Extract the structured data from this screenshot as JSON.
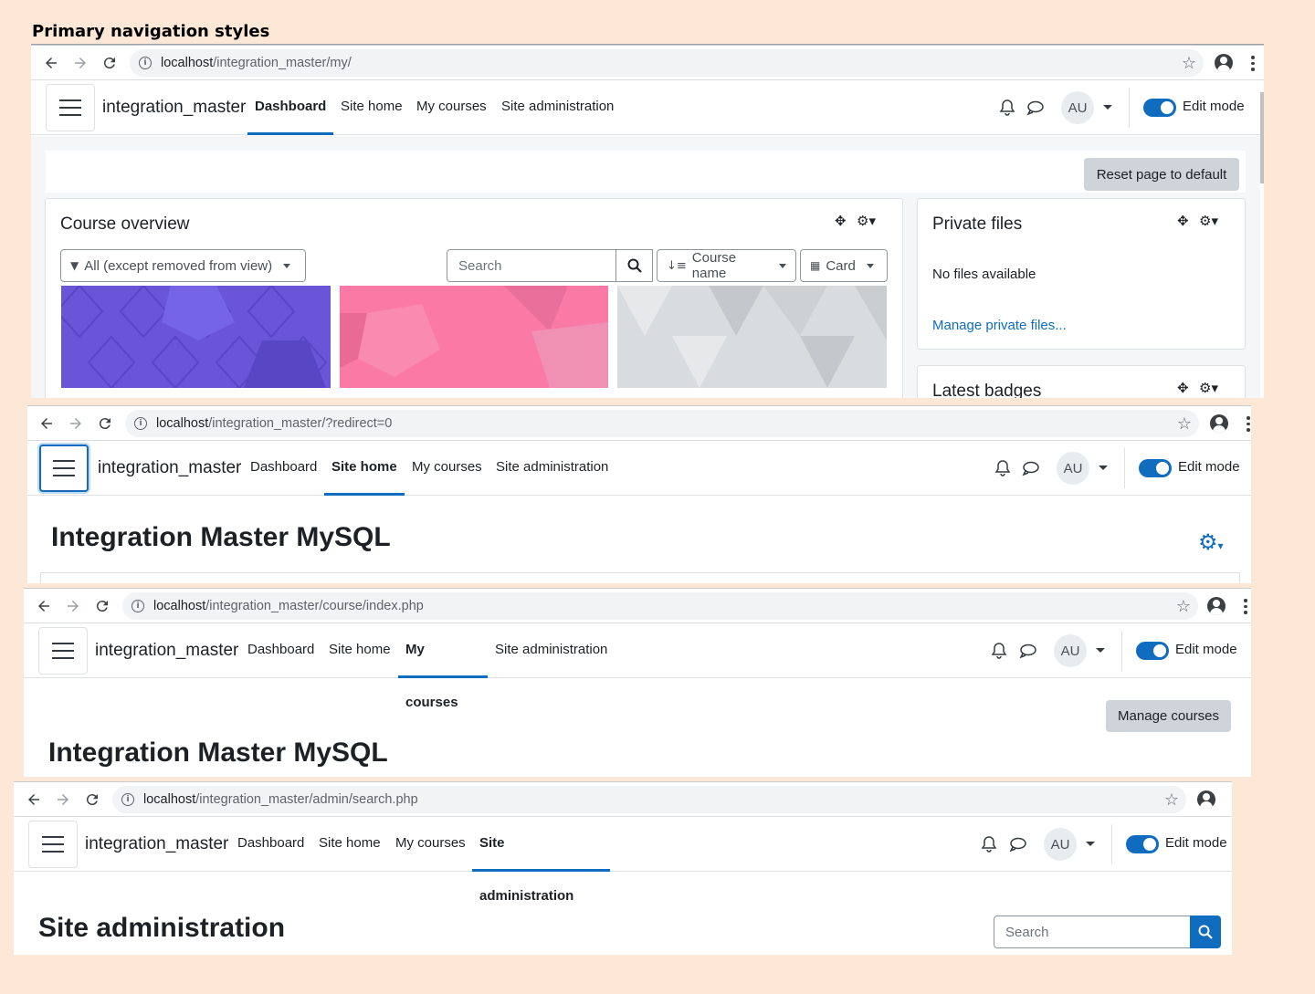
{
  "heading": "Primary navigation styles",
  "colors": {
    "accent": "#0f6cbf",
    "background": "#fde7d7",
    "secondary_button": "#ced4da"
  },
  "brand": "integration_master",
  "nav": {
    "dashboard": "Dashboard",
    "site_home": "Site home",
    "my_courses": "My courses",
    "site_admin": "Site administration"
  },
  "user_initials": "AU",
  "edit_mode_label": "Edit mode",
  "shots": [
    {
      "url_host": "localhost",
      "url_path": "/integration_master/my/",
      "active": "Dashboard"
    },
    {
      "url_host": "localhost",
      "url_path": "/integration_master/?redirect=0",
      "active": "Site home"
    },
    {
      "url_host": "localhost",
      "url_path": "/integration_master/course/index.php",
      "active": "My courses"
    },
    {
      "url_host": "localhost",
      "url_path": "/integration_master/admin/search.php",
      "active": "Site administration"
    }
  ],
  "dashboard": {
    "reset_button": "Reset page to default",
    "course_overview_title": "Course overview",
    "filter_label": "All (except removed from view)",
    "search_placeholder": "Search",
    "sort_label": "Course name",
    "view_label": "Card",
    "private_files_title": "Private files",
    "no_files": "No files available",
    "manage_files_link": "Manage private files...",
    "latest_badges_title": "Latest badges"
  },
  "site_home": {
    "title": "Integration Master MySQL"
  },
  "my_courses": {
    "manage_button": "Manage courses",
    "title": "Integration Master MySQL"
  },
  "site_admin": {
    "title": "Site administration",
    "search_placeholder": "Search"
  }
}
